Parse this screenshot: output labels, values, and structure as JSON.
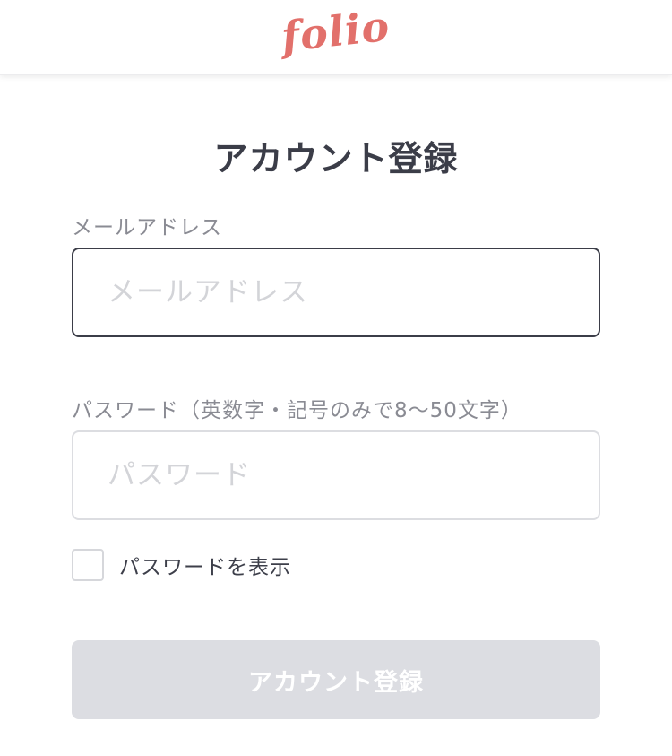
{
  "header": {
    "logo_text": "folio"
  },
  "form": {
    "title": "アカウント登録",
    "email": {
      "label": "メールアドレス",
      "placeholder": "メールアドレス",
      "value": ""
    },
    "password": {
      "label": "パスワード（英数字・記号のみで8〜50文字）",
      "placeholder": "パスワード",
      "value": ""
    },
    "show_password": {
      "label": "パスワードを表示",
      "checked": false
    },
    "submit_label": "アカウント登録"
  },
  "colors": {
    "brand": "#e2706b",
    "text_dark": "#3b3d48",
    "label_gray": "#8a8b93",
    "disabled_button": "#dcdde2"
  }
}
